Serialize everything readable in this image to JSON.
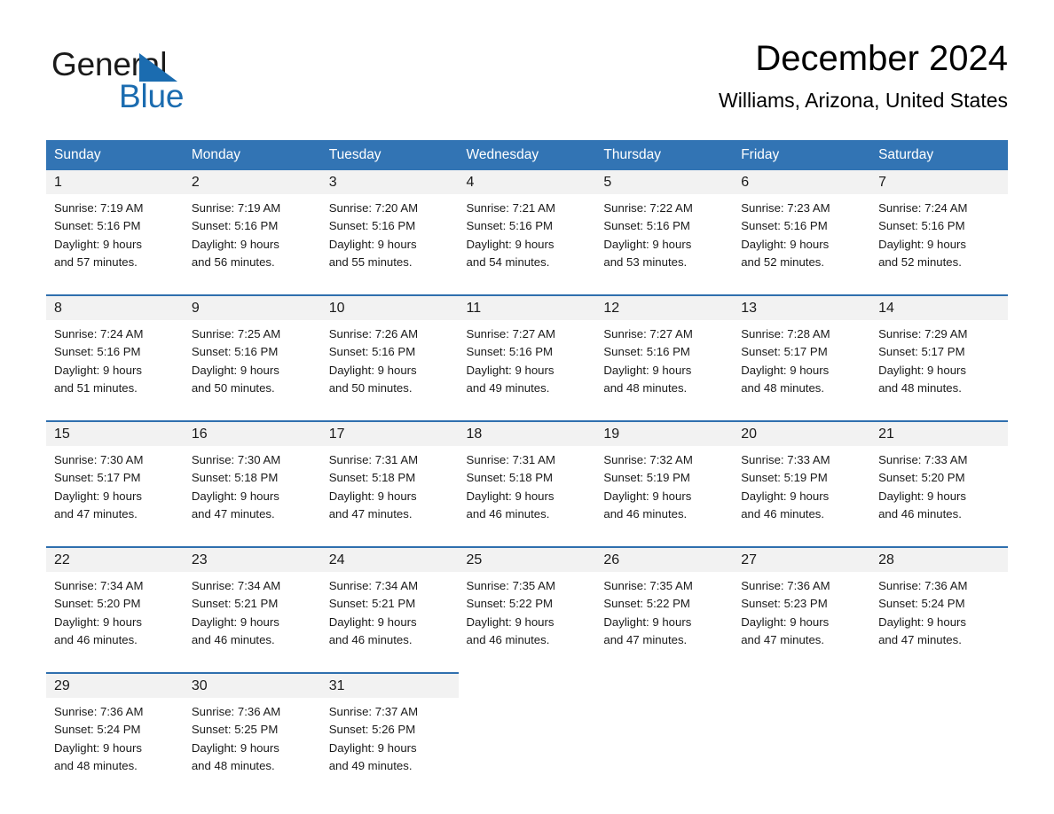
{
  "brand": {
    "name_part1": "General",
    "name_part2": "Blue",
    "accent_color": "#1b6cb0"
  },
  "header": {
    "month_title": "December 2024",
    "location": "Williams, Arizona, United States"
  },
  "calendar": {
    "header_bg": "#3274b4",
    "daynum_bg": "#f2f2f2",
    "separator_color": "#2f6fae",
    "weekday_headers": [
      "Sunday",
      "Monday",
      "Tuesday",
      "Wednesday",
      "Thursday",
      "Friday",
      "Saturday"
    ],
    "weeks": [
      {
        "days": [
          {
            "num": "1",
            "sunrise": "Sunrise: 7:19 AM",
            "sunset": "Sunset: 5:16 PM",
            "daylight_1": "Daylight: 9 hours",
            "daylight_2": "and 57 minutes."
          },
          {
            "num": "2",
            "sunrise": "Sunrise: 7:19 AM",
            "sunset": "Sunset: 5:16 PM",
            "daylight_1": "Daylight: 9 hours",
            "daylight_2": "and 56 minutes."
          },
          {
            "num": "3",
            "sunrise": "Sunrise: 7:20 AM",
            "sunset": "Sunset: 5:16 PM",
            "daylight_1": "Daylight: 9 hours",
            "daylight_2": "and 55 minutes."
          },
          {
            "num": "4",
            "sunrise": "Sunrise: 7:21 AM",
            "sunset": "Sunset: 5:16 PM",
            "daylight_1": "Daylight: 9 hours",
            "daylight_2": "and 54 minutes."
          },
          {
            "num": "5",
            "sunrise": "Sunrise: 7:22 AM",
            "sunset": "Sunset: 5:16 PM",
            "daylight_1": "Daylight: 9 hours",
            "daylight_2": "and 53 minutes."
          },
          {
            "num": "6",
            "sunrise": "Sunrise: 7:23 AM",
            "sunset": "Sunset: 5:16 PM",
            "daylight_1": "Daylight: 9 hours",
            "daylight_2": "and 52 minutes."
          },
          {
            "num": "7",
            "sunrise": "Sunrise: 7:24 AM",
            "sunset": "Sunset: 5:16 PM",
            "daylight_1": "Daylight: 9 hours",
            "daylight_2": "and 52 minutes."
          }
        ]
      },
      {
        "days": [
          {
            "num": "8",
            "sunrise": "Sunrise: 7:24 AM",
            "sunset": "Sunset: 5:16 PM",
            "daylight_1": "Daylight: 9 hours",
            "daylight_2": "and 51 minutes."
          },
          {
            "num": "9",
            "sunrise": "Sunrise: 7:25 AM",
            "sunset": "Sunset: 5:16 PM",
            "daylight_1": "Daylight: 9 hours",
            "daylight_2": "and 50 minutes."
          },
          {
            "num": "10",
            "sunrise": "Sunrise: 7:26 AM",
            "sunset": "Sunset: 5:16 PM",
            "daylight_1": "Daylight: 9 hours",
            "daylight_2": "and 50 minutes."
          },
          {
            "num": "11",
            "sunrise": "Sunrise: 7:27 AM",
            "sunset": "Sunset: 5:16 PM",
            "daylight_1": "Daylight: 9 hours",
            "daylight_2": "and 49 minutes."
          },
          {
            "num": "12",
            "sunrise": "Sunrise: 7:27 AM",
            "sunset": "Sunset: 5:16 PM",
            "daylight_1": "Daylight: 9 hours",
            "daylight_2": "and 48 minutes."
          },
          {
            "num": "13",
            "sunrise": "Sunrise: 7:28 AM",
            "sunset": "Sunset: 5:17 PM",
            "daylight_1": "Daylight: 9 hours",
            "daylight_2": "and 48 minutes."
          },
          {
            "num": "14",
            "sunrise": "Sunrise: 7:29 AM",
            "sunset": "Sunset: 5:17 PM",
            "daylight_1": "Daylight: 9 hours",
            "daylight_2": "and 48 minutes."
          }
        ]
      },
      {
        "days": [
          {
            "num": "15",
            "sunrise": "Sunrise: 7:30 AM",
            "sunset": "Sunset: 5:17 PM",
            "daylight_1": "Daylight: 9 hours",
            "daylight_2": "and 47 minutes."
          },
          {
            "num": "16",
            "sunrise": "Sunrise: 7:30 AM",
            "sunset": "Sunset: 5:18 PM",
            "daylight_1": "Daylight: 9 hours",
            "daylight_2": "and 47 minutes."
          },
          {
            "num": "17",
            "sunrise": "Sunrise: 7:31 AM",
            "sunset": "Sunset: 5:18 PM",
            "daylight_1": "Daylight: 9 hours",
            "daylight_2": "and 47 minutes."
          },
          {
            "num": "18",
            "sunrise": "Sunrise: 7:31 AM",
            "sunset": "Sunset: 5:18 PM",
            "daylight_1": "Daylight: 9 hours",
            "daylight_2": "and 46 minutes."
          },
          {
            "num": "19",
            "sunrise": "Sunrise: 7:32 AM",
            "sunset": "Sunset: 5:19 PM",
            "daylight_1": "Daylight: 9 hours",
            "daylight_2": "and 46 minutes."
          },
          {
            "num": "20",
            "sunrise": "Sunrise: 7:33 AM",
            "sunset": "Sunset: 5:19 PM",
            "daylight_1": "Daylight: 9 hours",
            "daylight_2": "and 46 minutes."
          },
          {
            "num": "21",
            "sunrise": "Sunrise: 7:33 AM",
            "sunset": "Sunset: 5:20 PM",
            "daylight_1": "Daylight: 9 hours",
            "daylight_2": "and 46 minutes."
          }
        ]
      },
      {
        "days": [
          {
            "num": "22",
            "sunrise": "Sunrise: 7:34 AM",
            "sunset": "Sunset: 5:20 PM",
            "daylight_1": "Daylight: 9 hours",
            "daylight_2": "and 46 minutes."
          },
          {
            "num": "23",
            "sunrise": "Sunrise: 7:34 AM",
            "sunset": "Sunset: 5:21 PM",
            "daylight_1": "Daylight: 9 hours",
            "daylight_2": "and 46 minutes."
          },
          {
            "num": "24",
            "sunrise": "Sunrise: 7:34 AM",
            "sunset": "Sunset: 5:21 PM",
            "daylight_1": "Daylight: 9 hours",
            "daylight_2": "and 46 minutes."
          },
          {
            "num": "25",
            "sunrise": "Sunrise: 7:35 AM",
            "sunset": "Sunset: 5:22 PM",
            "daylight_1": "Daylight: 9 hours",
            "daylight_2": "and 46 minutes."
          },
          {
            "num": "26",
            "sunrise": "Sunrise: 7:35 AM",
            "sunset": "Sunset: 5:22 PM",
            "daylight_1": "Daylight: 9 hours",
            "daylight_2": "and 47 minutes."
          },
          {
            "num": "27",
            "sunrise": "Sunrise: 7:36 AM",
            "sunset": "Sunset: 5:23 PM",
            "daylight_1": "Daylight: 9 hours",
            "daylight_2": "and 47 minutes."
          },
          {
            "num": "28",
            "sunrise": "Sunrise: 7:36 AM",
            "sunset": "Sunset: 5:24 PM",
            "daylight_1": "Daylight: 9 hours",
            "daylight_2": "and 47 minutes."
          }
        ]
      },
      {
        "days": [
          {
            "num": "29",
            "sunrise": "Sunrise: 7:36 AM",
            "sunset": "Sunset: 5:24 PM",
            "daylight_1": "Daylight: 9 hours",
            "daylight_2": "and 48 minutes."
          },
          {
            "num": "30",
            "sunrise": "Sunrise: 7:36 AM",
            "sunset": "Sunset: 5:25 PM",
            "daylight_1": "Daylight: 9 hours",
            "daylight_2": "and 48 minutes."
          },
          {
            "num": "31",
            "sunrise": "Sunrise: 7:37 AM",
            "sunset": "Sunset: 5:26 PM",
            "daylight_1": "Daylight: 9 hours",
            "daylight_2": "and 49 minutes."
          },
          {
            "num": "",
            "sunrise": "",
            "sunset": "",
            "daylight_1": "",
            "daylight_2": "",
            "empty": true
          },
          {
            "num": "",
            "sunrise": "",
            "sunset": "",
            "daylight_1": "",
            "daylight_2": "",
            "empty": true
          },
          {
            "num": "",
            "sunrise": "",
            "sunset": "",
            "daylight_1": "",
            "daylight_2": "",
            "empty": true
          },
          {
            "num": "",
            "sunrise": "",
            "sunset": "",
            "daylight_1": "",
            "daylight_2": "",
            "empty": true
          }
        ]
      }
    ]
  }
}
